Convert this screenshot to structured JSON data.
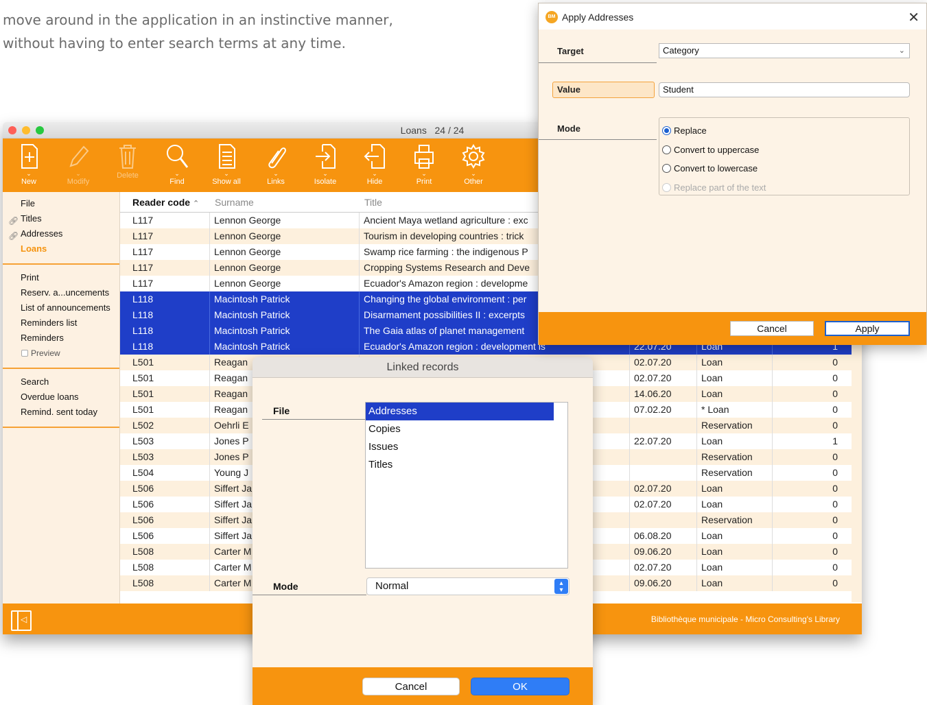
{
  "intro": {
    "line1": "move around in the application in an instinctive manner,",
    "line2": "without having to enter search terms at any time."
  },
  "main_window": {
    "title": "Loans",
    "count": "24 / 24",
    "toolbar": [
      {
        "label": "New",
        "icon": "new-document-icon",
        "enabled": true
      },
      {
        "label": "Modify",
        "icon": "pencil-icon",
        "enabled": false
      },
      {
        "label": "Delete",
        "icon": "trash-icon",
        "enabled": false
      },
      {
        "label": "Find",
        "icon": "magnifier-icon",
        "enabled": true
      },
      {
        "label": "Show all",
        "icon": "list-document-icon",
        "enabled": true
      },
      {
        "label": "Links",
        "icon": "paperclip-icon",
        "enabled": true
      },
      {
        "label": "Isolate",
        "icon": "isolate-icon",
        "enabled": true
      },
      {
        "label": "Hide",
        "icon": "hide-icon",
        "enabled": true
      },
      {
        "label": "Print",
        "icon": "printer-icon",
        "enabled": true
      },
      {
        "label": "Other",
        "icon": "gear-icon",
        "enabled": true
      }
    ],
    "sidebar": {
      "files": [
        {
          "label": "File",
          "linked": false,
          "active": false
        },
        {
          "label": "Titles",
          "linked": true,
          "active": false
        },
        {
          "label": "Addresses",
          "linked": true,
          "active": false
        },
        {
          "label": "Loans",
          "linked": false,
          "active": true
        }
      ],
      "print": [
        "Print",
        "Reserv. a...uncements",
        "List of announcements",
        "Reminders list",
        "Reminders"
      ],
      "preview_label": "Preview",
      "search": [
        "Search",
        "Overdue loans",
        "Remind. sent today"
      ]
    },
    "columns": {
      "code": "Reader code",
      "surname": "Surname",
      "title": "Title",
      "sort_arrow": "^"
    },
    "rows": [
      {
        "code": "L117",
        "surname": "Lennon George",
        "title": "Ancient Maya wetland agriculture : exc",
        "date": "",
        "type": "",
        "n": ""
      },
      {
        "code": "L117",
        "surname": "Lennon George",
        "title": "Tourism in developing countries : trick",
        "date": "",
        "type": "",
        "n": ""
      },
      {
        "code": "L117",
        "surname": "Lennon George",
        "title": "Swamp rice farming : the indigenous P",
        "date": "",
        "type": "",
        "n": ""
      },
      {
        "code": "L117",
        "surname": "Lennon George",
        "title": "Cropping Systems Research and Deve",
        "date": "",
        "type": "",
        "n": ""
      },
      {
        "code": "L117",
        "surname": "Lennon George",
        "title": "Ecuador's Amazon region : developme",
        "date": "",
        "type": "",
        "n": ""
      },
      {
        "code": "L118",
        "surname": "Macintosh Patrick",
        "title": "Changing the global environment : per",
        "date": "",
        "type": "",
        "n": ""
      },
      {
        "code": "L118",
        "surname": "Macintosh Patrick",
        "title": "Disarmament possibilities II : excerpts",
        "date": "",
        "type": "",
        "n": ""
      },
      {
        "code": "L118",
        "surname": "Macintosh Patrick",
        "title": "The Gaia atlas of planet management",
        "date": "",
        "type": "",
        "n": ""
      },
      {
        "code": "L118",
        "surname": "Macintosh Patrick",
        "title": "Ecuador's Amazon region : development is",
        "date": "22.07.20",
        "type": "Loan",
        "n": "1"
      },
      {
        "code": "L501",
        "surname": "Reagan",
        "title": "",
        "date": "02.07.20",
        "type": "Loan",
        "n": "0"
      },
      {
        "code": "L501",
        "surname": "Reagan",
        "title": "",
        "date": "02.07.20",
        "type": "Loan",
        "n": "0"
      },
      {
        "code": "L501",
        "surname": "Reagan",
        "title": "",
        "date": "14.06.20",
        "type": "Loan",
        "n": "0"
      },
      {
        "code": "L501",
        "surname": "Reagan",
        "title": "",
        "date": "07.02.20",
        "type": "* Loan",
        "n": "0"
      },
      {
        "code": "L502",
        "surname": "Oehrli E",
        "title": "",
        "date": "",
        "type": "Reservation",
        "n": "0"
      },
      {
        "code": "L503",
        "surname": "Jones P",
        "title": "",
        "date": "22.07.20",
        "type": "Loan",
        "n": "1"
      },
      {
        "code": "L503",
        "surname": "Jones P",
        "title": "",
        "date": "",
        "type": "Reservation",
        "n": "0"
      },
      {
        "code": "L504",
        "surname": "Young J",
        "title": "",
        "date": "",
        "type": "Reservation",
        "n": "0"
      },
      {
        "code": "L506",
        "surname": "Siffert Ja",
        "title": "",
        "date": "02.07.20",
        "type": "Loan",
        "n": "0"
      },
      {
        "code": "L506",
        "surname": "Siffert Ja",
        "title": "",
        "date": "02.07.20",
        "type": "Loan",
        "n": "0"
      },
      {
        "code": "L506",
        "surname": "Siffert Ja",
        "title": "",
        "date": "",
        "type": "Reservation",
        "n": "0"
      },
      {
        "code": "L506",
        "surname": "Siffert Ja",
        "title": "",
        "date": "06.08.20",
        "type": "Loan",
        "n": "0"
      },
      {
        "code": "L508",
        "surname": "Carter M",
        "title": "",
        "date": "09.06.20",
        "type": "Loan",
        "n": "0"
      },
      {
        "code": "L508",
        "surname": "Carter M",
        "title": "",
        "date": "02.07.20",
        "type": "Loan",
        "n": "0"
      },
      {
        "code": "L508",
        "surname": "Carter M",
        "title": "",
        "date": "09.06.20",
        "type": "Loan",
        "n": "0"
      }
    ],
    "selected_rows": [
      5,
      6,
      7,
      8
    ],
    "status_text": "Bibliothèque municipale - Micro Consulting's Library"
  },
  "linked_dialog": {
    "title": "Linked records",
    "file_label": "File",
    "files": [
      "Addresses",
      "Copies",
      "Issues",
      "Titles"
    ],
    "selected_file": "Addresses",
    "mode_label": "Mode",
    "mode_value": "Normal",
    "cancel_label": "Cancel",
    "ok_label": "OK"
  },
  "apply_dialog": {
    "title": "Apply Addresses",
    "logo_text": "BM",
    "target_label": "Target",
    "target_value": "Category",
    "value_label": "Value",
    "value_text": "Student",
    "mode_label": "Mode",
    "modes": [
      {
        "label": "Replace",
        "checked": true,
        "enabled": true
      },
      {
        "label": "Convert to uppercase",
        "checked": false,
        "enabled": true
      },
      {
        "label": "Convert to lowercase",
        "checked": false,
        "enabled": true
      },
      {
        "label": "Replace part of the text",
        "checked": false,
        "enabled": false
      }
    ],
    "cancel_label": "Cancel",
    "apply_label": "Apply"
  },
  "colors": {
    "accent": "#f7940f",
    "selection": "#1f3ec8",
    "row_alt": "#fdf0dd",
    "mac_button": "#2f7df6"
  }
}
